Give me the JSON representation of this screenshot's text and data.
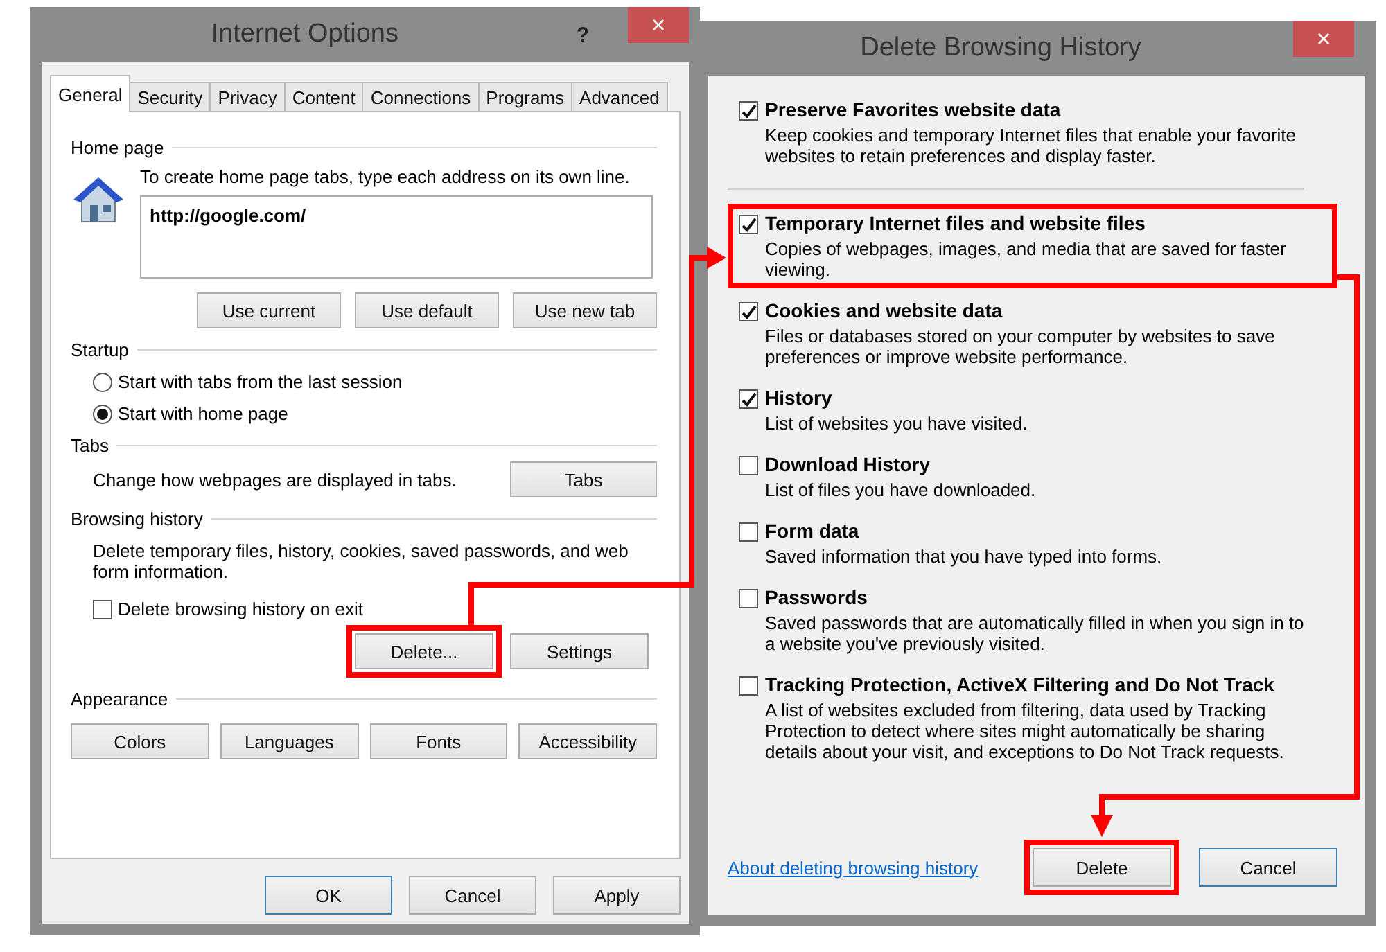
{
  "internet_options": {
    "title": "Internet Options",
    "help": "?",
    "close": "×",
    "tabs": [
      {
        "label": "General",
        "selected": true
      },
      {
        "label": "Security",
        "selected": false
      },
      {
        "label": "Privacy",
        "selected": false
      },
      {
        "label": "Content",
        "selected": false
      },
      {
        "label": "Connections",
        "selected": false
      },
      {
        "label": "Programs",
        "selected": false
      },
      {
        "label": "Advanced",
        "selected": false
      }
    ],
    "home_page": {
      "heading": "Home page",
      "instruction": "To create home page tabs, type each address on its own line.",
      "value": "http://google.com/",
      "buttons": [
        "Use current",
        "Use default",
        "Use new tab"
      ]
    },
    "startup": {
      "heading": "Startup",
      "options": [
        {
          "label": "Start with tabs from the last session",
          "selected": false
        },
        {
          "label": "Start with home page",
          "selected": true
        }
      ]
    },
    "tabs_section": {
      "heading": "Tabs",
      "description": "Change how webpages are displayed in tabs.",
      "button": "Tabs"
    },
    "browsing_history": {
      "heading": "Browsing history",
      "description": "Delete temporary files, history, cookies, saved passwords, and web form information.",
      "checkbox": {
        "label": "Delete browsing history on exit",
        "checked": false
      },
      "buttons": [
        {
          "label": "Delete...",
          "highlighted": true
        },
        {
          "label": "Settings",
          "highlighted": false
        }
      ]
    },
    "appearance": {
      "heading": "Appearance",
      "buttons": [
        "Colors",
        "Languages",
        "Fonts",
        "Accessibility"
      ]
    },
    "footer_buttons": [
      {
        "label": "OK",
        "default": true
      },
      {
        "label": "Cancel",
        "default": false
      },
      {
        "label": "Apply",
        "default": false
      }
    ]
  },
  "delete_browsing_history": {
    "title": "Delete Browsing History",
    "close": "×",
    "options": [
      {
        "label": "Preserve Favorites website data",
        "description": "Keep cookies and temporary Internet files that enable your favorite websites to retain preferences and display faster.",
        "checked": true,
        "highlighted": false
      },
      {
        "label": "Temporary Internet files and website files",
        "description": "Copies of webpages, images, and media that are saved for faster viewing.",
        "checked": true,
        "highlighted": true
      },
      {
        "label": "Cookies and website data",
        "description": "Files or databases stored on your computer by websites to save preferences or improve website performance.",
        "checked": true,
        "highlighted": false
      },
      {
        "label": "History",
        "description": "List of websites you have visited.",
        "checked": true,
        "highlighted": false
      },
      {
        "label": "Download History",
        "description": "List of files you have downloaded.",
        "checked": false,
        "highlighted": false
      },
      {
        "label": "Form data",
        "description": "Saved information that you have typed into forms.",
        "checked": false,
        "highlighted": false
      },
      {
        "label": "Passwords",
        "description": "Saved passwords that are automatically filled in when you sign in to a website you've previously visited.",
        "checked": false,
        "highlighted": false
      },
      {
        "label": "Tracking Protection, ActiveX Filtering and Do Not Track",
        "description": "A list of websites excluded from filtering, data used by Tracking Protection to detect where sites might automatically be sharing details about your visit, and exceptions to Do Not Track requests.",
        "checked": false,
        "highlighted": false
      }
    ],
    "link": "About deleting browsing history",
    "buttons": [
      {
        "label": "Delete",
        "highlighted": true,
        "default": false
      },
      {
        "label": "Cancel",
        "highlighted": false,
        "default": true
      }
    ]
  }
}
